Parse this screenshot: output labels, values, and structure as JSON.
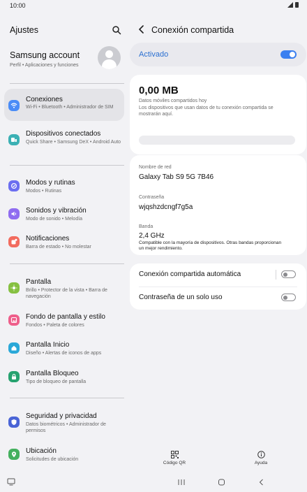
{
  "status_bar": {
    "time": "10:00"
  },
  "settings": {
    "title": "Ajustes",
    "account": {
      "name": "Samsung account",
      "subtitle": "Perfil • Aplicaciones y funciones"
    },
    "items": [
      {
        "title": "Conexiones",
        "subtitle": "Wi-Fi • Bluetooth • Administrador de SIM",
        "icon": "wifi-icon",
        "color": "#4a8cf7"
      },
      {
        "title": "Dispositivos conectados",
        "subtitle": "Quick Share • Samsung DeX • Android Auto",
        "icon": "devices-icon",
        "color": "#3bb0b4"
      },
      {
        "title": "Modos y rutinas",
        "subtitle": "Modos • Rutinas",
        "icon": "modes-icon",
        "color": "#6b6ef0"
      },
      {
        "title": "Sonidos y vibración",
        "subtitle": "Modo de sonido • Melodía",
        "icon": "sound-icon",
        "color": "#8f6cf0"
      },
      {
        "title": "Notificaciones",
        "subtitle": "Barra de estado • No molestar",
        "icon": "notification-icon",
        "color": "#f26b5e"
      },
      {
        "title": "Pantalla",
        "subtitle": "Brillo • Protector de la vista • Barra de navegación",
        "icon": "brightness-icon",
        "color": "#86c041"
      },
      {
        "title": "Fondo de pantalla y estilo",
        "subtitle": "Fondos • Paleta de colores",
        "icon": "wallpaper-icon",
        "color": "#ee5e8a"
      },
      {
        "title": "Pantalla Inicio",
        "subtitle": "Diseño • Alertas de iconos de apps",
        "icon": "home-icon",
        "color": "#2aa8d8"
      },
      {
        "title": "Pantalla Bloqueo",
        "subtitle": "Tipo de bloqueo de pantalla",
        "icon": "lock-icon",
        "color": "#26a26f"
      },
      {
        "title": "Seguridad y privacidad",
        "subtitle": "Datos biométricos • Administrador de permisos",
        "icon": "shield-icon",
        "color": "#4a64d6"
      },
      {
        "title": "Ubicación",
        "subtitle": "Solicitudes de ubicación",
        "icon": "location-icon",
        "color": "#44b05e"
      }
    ]
  },
  "hotspot": {
    "title": "Conexión compartida",
    "toggle_label": "Activado",
    "data": {
      "amount": "0,00 MB",
      "subtitle": "Datos móviles compartidos hoy",
      "description": "Los dispositivos que usan datos de tu conexión compartida se mostrarán aquí."
    },
    "network": {
      "name_label": "Nombre de red",
      "name_value": "Galaxy Tab S9 5G 7B46",
      "password_label": "Contraseña",
      "password_value": "wjqshzdcngf7g5a",
      "band_label": "Banda",
      "band_value": "2,4 GHz",
      "band_note": "Compatible con la mayoría de dispositivos. Otras bandas proporcionan un mejor rendimiento."
    },
    "options": [
      {
        "label": "Conexión compartida automática"
      },
      {
        "label": "Contraseña de un solo uso"
      }
    ],
    "actions": {
      "qr_label": "Código QR",
      "help_label": "Ayuda"
    }
  }
}
